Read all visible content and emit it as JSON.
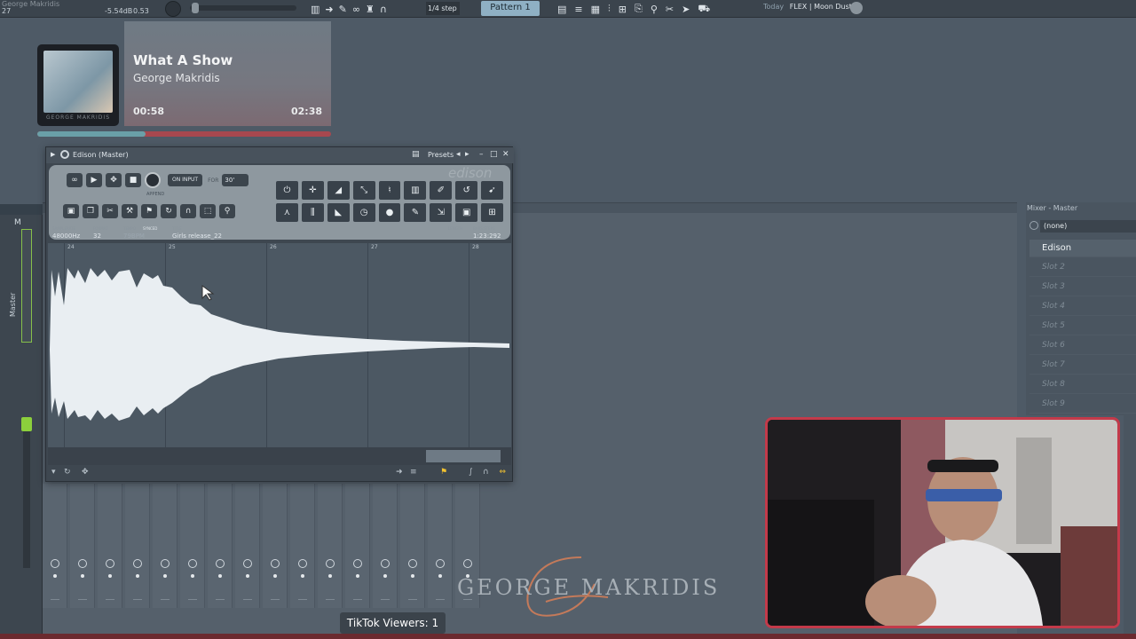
{
  "toolbar": {
    "project_name": "George Makridis",
    "line2_left": "27",
    "db_value": "-5.54dB",
    "db_secondary": "0.53",
    "snap": "1/4 step",
    "pattern": "Pattern 1",
    "hint_today": "Today",
    "hint_text": "FLEX | Moon Dust"
  },
  "now_playing": {
    "title": "What A Show",
    "artist": "George Makridis",
    "current_time": "00:58",
    "duration": "02:38",
    "art_caption": "GEORGE MAKRIDIS",
    "progress": 0.37
  },
  "edison": {
    "window_title": "Edison (Master)",
    "presets_label": "Presets",
    "logo": "edison",
    "on_input": "ON INPUT",
    "for_label": "FOR",
    "rec_length": "30'",
    "append_label": "APPEND",
    "info": {
      "samplerate_label": "SAMPLERATE",
      "samplerate": "48000Hz",
      "format_label": "FORMAT",
      "format": "32",
      "tempo_label": "TEMPO",
      "tempo": "79BPM",
      "synced_label": "SYNCED",
      "title_label": "TITLE",
      "title": "Girls release_22",
      "length_label": "LENGTH",
      "bars_label": "BARS:STEPS",
      "length": "1:23:292"
    },
    "ruler": [
      "24",
      "25",
      "26",
      "27",
      "28"
    ]
  },
  "left_strip": {
    "top_label": "M",
    "master_label": "Master"
  },
  "mixer_panel": {
    "title": "Mixer - Master",
    "selector": "(none)",
    "slots": [
      "Edison",
      "Slot 2",
      "Slot 3",
      "Slot 4",
      "Slot 5",
      "Slot 6",
      "Slot 7",
      "Slot 8",
      "Slot 9"
    ]
  },
  "watermark": "GEORGE MAKRIDIS",
  "viewers": "TikTok Viewers: 1",
  "colors": {
    "accent_green": "#8ccf3c",
    "cam_border": "#c33a4a",
    "pattern_bg": "#8fb0c4"
  }
}
